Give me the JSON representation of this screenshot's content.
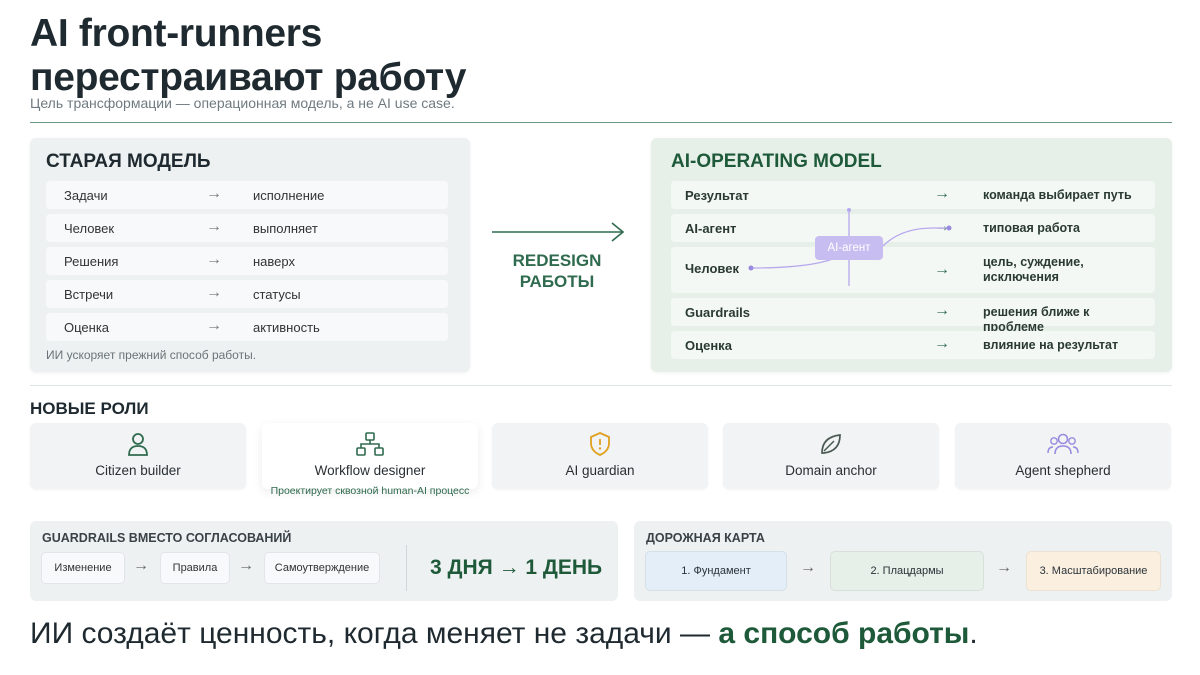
{
  "title": {
    "line1": "AI front-runners",
    "line2": "перестраивают работу",
    "subtitle": "Цель трансформации — операционная модель, а не AI use case."
  },
  "old_model": {
    "heading": "СТАРАЯ МОДЕЛЬ",
    "rows": [
      {
        "left": "Задачи",
        "right": "исполнение"
      },
      {
        "left": "Человек",
        "right": "выполняет"
      },
      {
        "left": "Решения",
        "right": "наверх"
      },
      {
        "left": "Встречи",
        "right": "статусы"
      },
      {
        "left": "Оценка",
        "right": "активность"
      }
    ],
    "note": "ИИ ускоряет прежний способ работы."
  },
  "redesign": {
    "line1": "REDESIGN",
    "line2": "РАБОТЫ"
  },
  "new_model": {
    "heading": "AI-OPERATING MODEL",
    "agent_label": "AI-агент",
    "rows": [
      {
        "left": "Результат",
        "right": "команда выбирает путь"
      },
      {
        "left": "AI-агент",
        "right": "типовая работа"
      },
      {
        "left": "Человек",
        "right": "цель, суждение, исключения"
      },
      {
        "left": "Guardrails",
        "right": "решения ближе к проблеме"
      },
      {
        "left": "Оценка",
        "right": "влияние на результат"
      }
    ]
  },
  "roles": {
    "heading": "НОВЫЕ РОЛИ",
    "items": [
      {
        "label": "Citizen builder",
        "icon": "person-icon",
        "color": "#2f6b4e"
      },
      {
        "label": "Workflow designer",
        "icon": "hierarchy-icon",
        "color": "#2f6b4e",
        "description": "Проектирует сквозной human-AI процесс"
      },
      {
        "label": "AI guardian",
        "icon": "shield-icon",
        "color": "#e0a020"
      },
      {
        "label": "Domain anchor",
        "icon": "leaf-icon",
        "color": "#4a5a52"
      },
      {
        "label": "Agent shepherd",
        "icon": "group-icon",
        "color": "#9a8ae0"
      }
    ]
  },
  "guardrails": {
    "heading": "GUARDRAILS ВМЕСТО СОГЛАСОВАНИЙ",
    "steps": [
      "Изменение",
      "Правила",
      "Самоутверждение"
    ],
    "result": "3 ДНЯ → 1 ДЕНЬ"
  },
  "roadmap": {
    "heading": "ДОРОЖНАЯ КАРТА",
    "steps": [
      "1. Фундамент",
      "2. Плацдармы",
      "3. Масштабирование"
    ]
  },
  "footer": {
    "main": "ИИ создаёт ценность, когда меняет не задачи — ",
    "accent": "а способ работы",
    "end": "."
  },
  "colors": {
    "accent_green": "#1e5a3a",
    "agent_purple": "#c8bdf1"
  }
}
